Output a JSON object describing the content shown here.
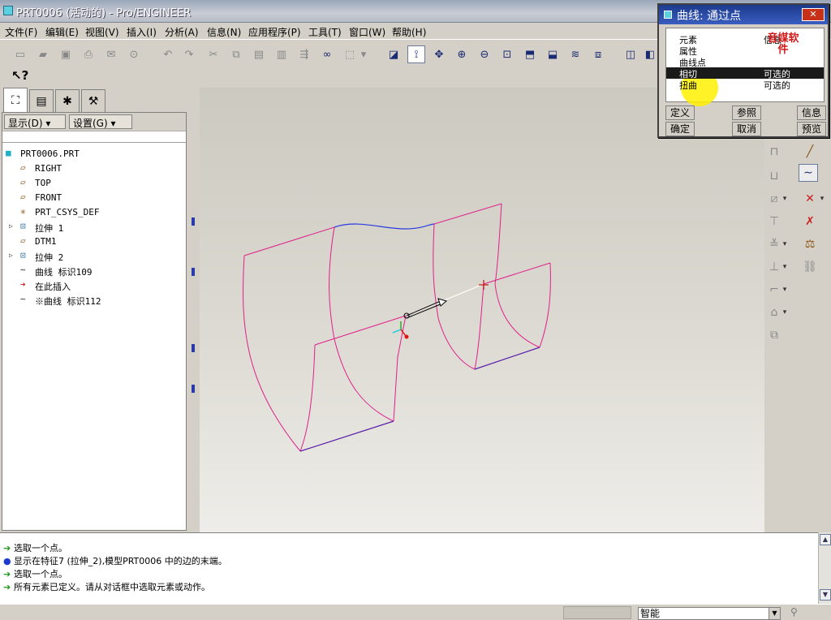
{
  "window": {
    "title": "PRT0006 (活动的) - Pro/ENGINEER"
  },
  "menu": [
    "文件(F)",
    "编辑(E)",
    "视图(V)",
    "插入(I)",
    "分析(A)",
    "信息(N)",
    "应用程序(P)",
    "工具(T)",
    "窗口(W)",
    "帮助(H)"
  ],
  "nav": {
    "show_label": "显示(D) ▾",
    "settings_label": "设置(G) ▾",
    "tree": [
      {
        "icon": "part-icon",
        "glyph": "■",
        "label": "PRT0006.PRT",
        "indent": 0,
        "color": "#20b0c8"
      },
      {
        "icon": "datum-plane-icon",
        "glyph": "▱",
        "label": "RIGHT",
        "indent": 1,
        "color": "#8a5010"
      },
      {
        "icon": "datum-plane-icon",
        "glyph": "▱",
        "label": "TOP",
        "indent": 1,
        "color": "#8a5010"
      },
      {
        "icon": "datum-plane-icon",
        "glyph": "▱",
        "label": "FRONT",
        "indent": 1,
        "color": "#8a5010"
      },
      {
        "icon": "csys-icon",
        "glyph": "✳",
        "label": "PRT_CSYS_DEF",
        "indent": 1,
        "color": "#8a5010"
      },
      {
        "icon": "extrude-icon",
        "glyph": "⊡",
        "label": "拉伸 1",
        "indent": 1,
        "color": "#2a6aa0",
        "expand": true
      },
      {
        "icon": "datum-plane-icon",
        "glyph": "▱",
        "label": "DTM1",
        "indent": 1,
        "color": "#8a5010"
      },
      {
        "icon": "extrude-icon",
        "glyph": "⊡",
        "label": "拉伸 2",
        "indent": 1,
        "color": "#2a6aa0",
        "expand": true
      },
      {
        "icon": "curve-icon",
        "glyph": "∼",
        "label": "曲线 标识109",
        "indent": 1,
        "color": "#303030"
      },
      {
        "icon": "insert-here-arrow-icon",
        "glyph": "➔",
        "label": "在此插入",
        "indent": 1,
        "color": "#d01010"
      },
      {
        "icon": "curve-icon",
        "glyph": "∼",
        "label": "※曲线 标识112",
        "indent": 1,
        "color": "#303030"
      }
    ]
  },
  "messages": [
    {
      "icon": "prompt-arrow-icon",
      "glyph": "➔",
      "color": "#1a9a1a",
      "text": "选取一个点。"
    },
    {
      "icon": "info-bullet-icon",
      "glyph": "●",
      "color": "#1a3ad0",
      "text": "显示在特征7 (拉伸_2),模型PRT0006 中的边的末端。"
    },
    {
      "icon": "prompt-arrow-icon",
      "glyph": "➔",
      "color": "#1a9a1a",
      "text": "选取一个点。"
    },
    {
      "icon": "prompt-arrow-icon",
      "glyph": "➔",
      "color": "#1a9a1a",
      "text": "所有元素已定义。请从对话框中选取元素或动作。"
    }
  ],
  "status": {
    "filter_value": "智能"
  },
  "dialog": {
    "title": "曲线: 通过点",
    "close": "✕",
    "header": {
      "element": "元素",
      "info": "信息"
    },
    "rows": [
      {
        "element": "属性",
        "info": ""
      },
      {
        "element": "曲线点",
        "info": ""
      },
      {
        "element": "相切",
        "info": "可选的"
      },
      {
        "element": "扭曲",
        "info": "可选的"
      }
    ],
    "watermark": "音媒软件",
    "buttons": {
      "define": "定义",
      "reference": "参照",
      "info": "信息",
      "ok": "确定",
      "cancel": "取消",
      "preview": "预览"
    }
  }
}
